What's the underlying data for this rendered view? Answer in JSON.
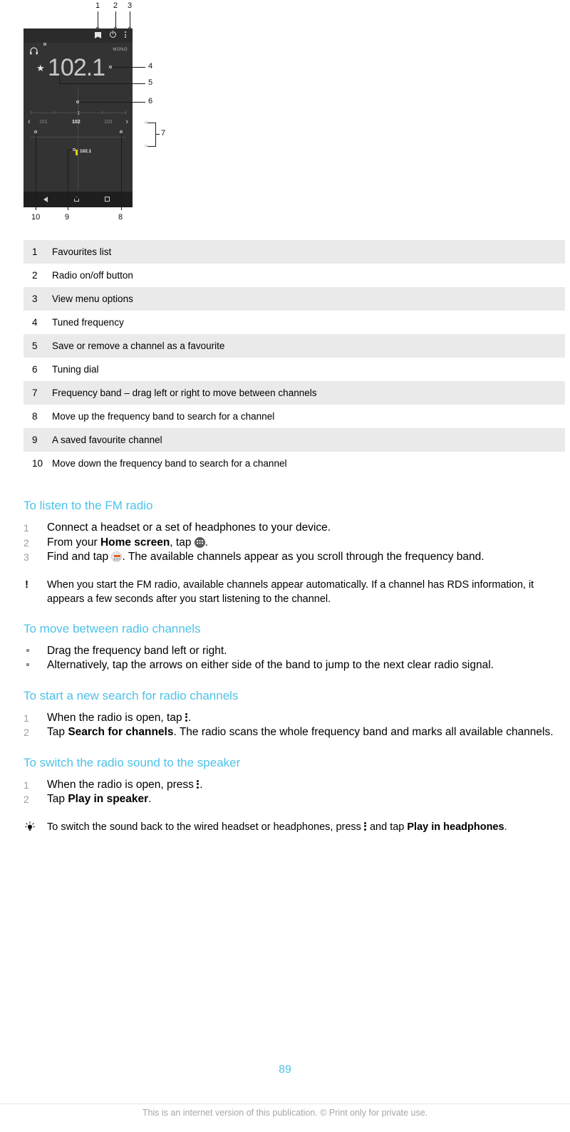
{
  "figure": {
    "callout_numbers": [
      "1",
      "2",
      "3",
      "4",
      "5",
      "6",
      "7",
      "8",
      "9",
      "10"
    ],
    "phone": {
      "mono_label": "MONO",
      "tuned_frequency": "102.1",
      "band_labels": [
        "101",
        "102",
        "103"
      ],
      "favourite_marker_label": "102.1",
      "left_arrow": "‹",
      "right_arrow": "›",
      "star_glyph": "★",
      "headset_icon": "headphones-icon"
    }
  },
  "legend": {
    "rows": [
      {
        "num": "1",
        "text": "Favourites list"
      },
      {
        "num": "2",
        "text": "Radio on/off button"
      },
      {
        "num": "3",
        "text": "View menu options"
      },
      {
        "num": "4",
        "text": "Tuned frequency"
      },
      {
        "num": "5",
        "text": "Save or remove a channel as a favourite"
      },
      {
        "num": "6",
        "text": "Tuning dial"
      },
      {
        "num": "7",
        "text": "Frequency band – drag left or right to move between channels"
      },
      {
        "num": "8",
        "text": "Move up the frequency band to search for a channel"
      },
      {
        "num": "9",
        "text": "A saved favourite channel"
      },
      {
        "num": "10",
        "text": "Move down the frequency band to search for a channel"
      }
    ]
  },
  "sections": {
    "listen": {
      "heading": "To listen to the FM radio",
      "steps": [
        {
          "num": "1",
          "pre": "Connect a headset or a set of headphones to your device.",
          "bold": "",
          "post": ""
        },
        {
          "num": "2",
          "pre": "From your ",
          "bold": "Home screen",
          "post": ", tap ",
          "icon": "app-drawer-icon",
          "tail": "."
        },
        {
          "num": "3",
          "pre": "Find and tap ",
          "bold": "",
          "post": "",
          "icon": "fm-radio-app-icon",
          "tail": ". The available channels appear as you scroll through the frequency band."
        }
      ],
      "note": {
        "icon": "exclamation-note-icon",
        "glyph": "!",
        "text": "When you start the FM radio, available channels appear automatically. If a channel has RDS information, it appears a few seconds after you start listening to the channel."
      }
    },
    "move": {
      "heading": "To move between radio channels",
      "bullets": [
        "Drag the frequency band left or right.",
        "Alternatively, tap the arrows on either side of the band to jump to the next clear radio signal."
      ]
    },
    "search": {
      "heading": "To start a new search for radio channels",
      "steps": [
        {
          "num": "1",
          "pre": "When the radio is open, tap ",
          "icon": "kebab-menu-icon",
          "tail": "."
        },
        {
          "num": "2",
          "pre": "Tap ",
          "bold": "Search for channels",
          "tail": ". The radio scans the whole frequency band and marks all available channels."
        }
      ]
    },
    "speaker": {
      "heading": "To switch the radio sound to the speaker",
      "steps": [
        {
          "num": "1",
          "pre": "When the radio is open, press ",
          "icon": "kebab-menu-icon",
          "tail": "."
        },
        {
          "num": "2",
          "pre": "Tap ",
          "bold": "Play in speaker",
          "tail": "."
        }
      ],
      "tip": {
        "icon": "lightbulb-tip-icon",
        "pre": "To switch the sound back to the wired headset or headphones, press ",
        "mid": " and tap ",
        "bold": "Play in headphones",
        "tail": "."
      }
    }
  },
  "footer": {
    "page_number": "89",
    "disclaimer": "This is an internet version of this publication. © Print only for private use."
  },
  "colors": {
    "heading": "#4cc2e8",
    "page_number": "#4cc2e8",
    "table_alt_row": "#eaeaea",
    "footer_text": "#a7a7a7",
    "step_number": "#9d9d9d",
    "phone_bg": "#333333",
    "favourite_marker": "#d8d200"
  }
}
